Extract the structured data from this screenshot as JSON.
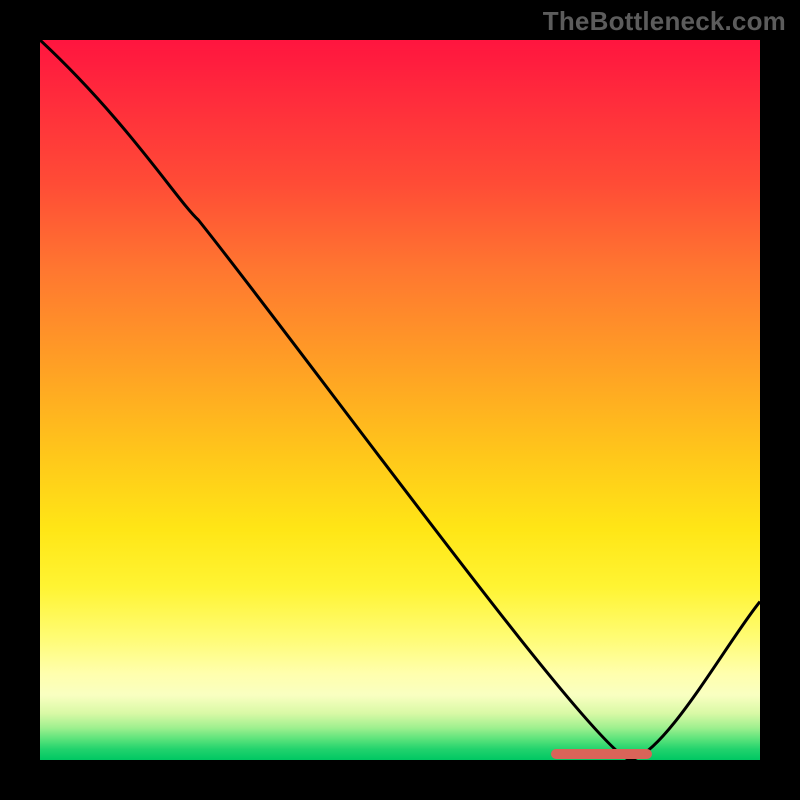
{
  "watermark": "TheBottleneck.com",
  "chart_data": {
    "type": "line",
    "title": "",
    "xlabel": "",
    "ylabel": "",
    "xlim": [
      0,
      100
    ],
    "ylim": [
      0,
      100
    ],
    "grid": false,
    "legend": false,
    "background_gradient": {
      "direction": "vertical",
      "stops": [
        {
          "pos": 0,
          "color": "#ff153f"
        },
        {
          "pos": 20,
          "color": "#ff4c36"
        },
        {
          "pos": 46,
          "color": "#ffa224"
        },
        {
          "pos": 68,
          "color": "#ffe616"
        },
        {
          "pos": 88,
          "color": "#ffffad"
        },
        {
          "pos": 100,
          "color": "#00c763"
        }
      ]
    },
    "series": [
      {
        "name": "bottleneck-curve",
        "stroke": "#000000",
        "x": [
          0,
          22,
          82,
          100
        ],
        "y": [
          100,
          75,
          0,
          22
        ]
      }
    ],
    "marker": {
      "name": "optimal-range",
      "color": "#d96459",
      "x_start": 71,
      "x_end": 85,
      "y": 0.8
    }
  }
}
